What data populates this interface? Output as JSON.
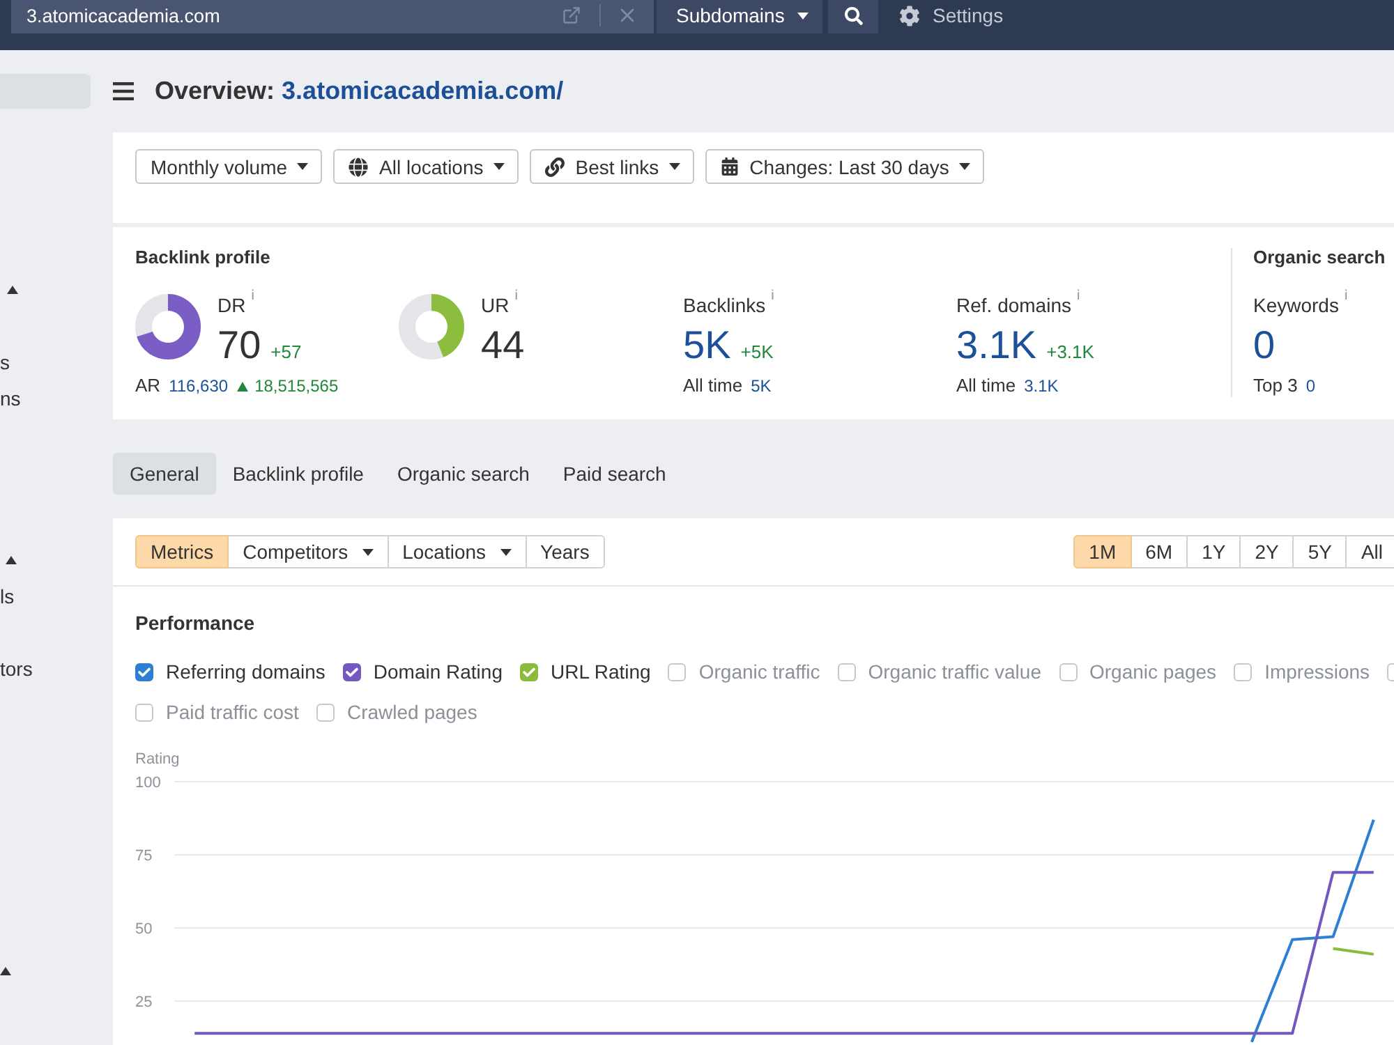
{
  "top_bar": {
    "url": "3.atomicacademia.com",
    "scope": "Subdomains",
    "settings": "Settings"
  },
  "sidebar": {
    "items": [
      {
        "selected": true
      }
    ],
    "sections": [
      {
        "expanded": true,
        "items": [
          "s",
          "ns"
        ]
      },
      {
        "expanded": true,
        "items": [
          "ls",
          "tors"
        ]
      },
      {
        "expanded": true
      }
    ]
  },
  "page_title": {
    "label": "Overview:",
    "domain": "3.atomicacademia.com/"
  },
  "filters": [
    {
      "kind": "volume",
      "label": "Monthly volume"
    },
    {
      "kind": "location",
      "label": "All locations"
    },
    {
      "kind": "links",
      "label": "Best links"
    },
    {
      "kind": "period",
      "label": "Changes: Last 30 days"
    }
  ],
  "backlink_profile": {
    "title": "Backlink profile",
    "ratings": [
      {
        "label": "DR",
        "info": "i",
        "value": "70",
        "delta": "+57",
        "level": 0.7,
        "color": "#7a5ec6",
        "ar": {
          "label": "AR",
          "value": "116,630",
          "change": "18,515,565",
          "up": true
        }
      },
      {
        "label": "UR",
        "info": "i",
        "value": "44",
        "level": 0.44,
        "color": "#8dbd3e"
      }
    ],
    "counts": [
      {
        "label": "Backlinks",
        "info": "i",
        "value": "5K",
        "delta": "+5K",
        "sub_label": "All time",
        "sub_value": "5K"
      },
      {
        "label": "Ref. domains",
        "info": "i",
        "value": "3.1K",
        "delta": "+3.1K",
        "sub_label": "All time",
        "sub_value": "3.1K"
      }
    ]
  },
  "organic_search": {
    "title": "Organic search",
    "label": "Keywords",
    "info": "i",
    "value": "0",
    "sub_label": "Top 3",
    "sub_value": "0"
  },
  "tabs": [
    {
      "label": "General",
      "selected": true
    },
    {
      "label": "Backlink profile",
      "selected": false
    },
    {
      "label": "Organic search",
      "selected": false
    },
    {
      "label": "Paid search",
      "selected": false
    }
  ],
  "chart_toolbar": {
    "views": [
      {
        "label": "Metrics",
        "selected": true,
        "dropdown": false
      },
      {
        "label": "Competitors",
        "selected": false,
        "dropdown": true
      },
      {
        "label": "Locations",
        "selected": false,
        "dropdown": true
      },
      {
        "label": "Years",
        "selected": false,
        "dropdown": false
      }
    ],
    "ranges": [
      {
        "label": "1M",
        "selected": true
      },
      {
        "label": "6M",
        "selected": false
      },
      {
        "label": "1Y",
        "selected": false
      },
      {
        "label": "2Y",
        "selected": false
      },
      {
        "label": "5Y",
        "selected": false
      },
      {
        "label": "All",
        "selected": false
      }
    ]
  },
  "performance": {
    "title": "Performance",
    "metrics": [
      {
        "label": "Referring domains",
        "checked": true,
        "color": "#2d7fd4"
      },
      {
        "label": "Domain Rating",
        "checked": true,
        "color": "#7458c2"
      },
      {
        "label": "URL Rating",
        "checked": true,
        "color": "#8bbb3c"
      },
      {
        "label": "Organic traffic",
        "checked": false
      },
      {
        "label": "Organic traffic value",
        "checked": false
      },
      {
        "label": "Organic pages",
        "checked": false
      },
      {
        "label": "Impressions",
        "checked": false
      },
      {
        "checked": false
      },
      {
        "label": "Paid traffic cost",
        "checked": false
      },
      {
        "label": "Crawled pages",
        "checked": false
      }
    ],
    "chart_data": {
      "type": "line",
      "ylabel": "Rating",
      "ylim": [
        10,
        100
      ],
      "yticks": [
        25,
        50,
        75,
        100
      ],
      "grid": true,
      "series": [
        {
          "color": "#2d7fd4",
          "values": [
            null,
            null,
            null,
            null,
            null,
            null,
            null,
            null,
            null,
            null,
            null,
            null,
            null,
            null,
            null,
            null,
            null,
            null,
            null,
            null,
            null,
            null,
            null,
            null,
            null,
            null,
            11,
            46,
            47,
            87
          ]
        },
        {
          "color": "#7458c2",
          "values": [
            14,
            14,
            14,
            14,
            14,
            14,
            14,
            14,
            14,
            14,
            14,
            14,
            14,
            14,
            14,
            14,
            14,
            14,
            14,
            14,
            14,
            14,
            14,
            14,
            14,
            14,
            14,
            14,
            69,
            69
          ]
        },
        {
          "color": "#8bbb3c",
          "values": [
            null,
            null,
            null,
            null,
            null,
            null,
            null,
            null,
            null,
            null,
            null,
            null,
            null,
            null,
            null,
            null,
            null,
            null,
            null,
            null,
            null,
            null,
            null,
            null,
            null,
            null,
            null,
            null,
            43,
            41
          ]
        }
      ]
    }
  }
}
